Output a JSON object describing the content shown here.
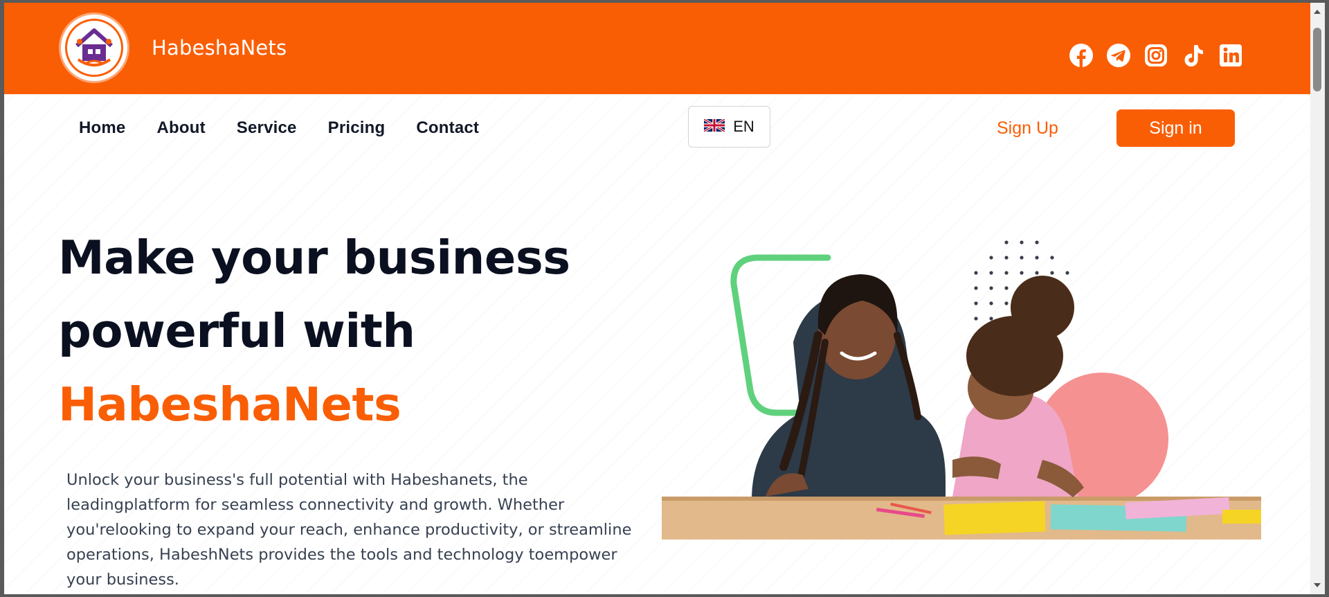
{
  "header": {
    "brand": "HabeshaNets",
    "logo_icon": "home-family-logo",
    "socials": [
      {
        "name": "facebook-icon"
      },
      {
        "name": "telegram-icon"
      },
      {
        "name": "instagram-icon"
      },
      {
        "name": "tiktok-icon"
      },
      {
        "name": "linkedin-icon"
      }
    ]
  },
  "nav": {
    "links": [
      "Home",
      "About",
      "Service",
      "Pricing",
      "Contact"
    ],
    "language": {
      "code": "EN",
      "flag_icon": "uk-flag-icon"
    },
    "signup_label": "Sign Up",
    "signin_label": "Sign in"
  },
  "hero": {
    "title_line1": "Make your business",
    "title_line2": "powerful with",
    "title_accent": "HabeshaNets",
    "description": "Unlock your business's full potential with Habeshanets, the leadingplatform for seamless connectivity and growth. Whether you'relooking to expand your reach, enhance productivity, or streamline operations, HabeshNets provides the tools and technology toempower your business."
  },
  "colors": {
    "brand_orange": "#fa5e05",
    "heading_dark": "#0b1020",
    "accent_green": "#5fd17d",
    "accent_pink": "#f69191"
  }
}
